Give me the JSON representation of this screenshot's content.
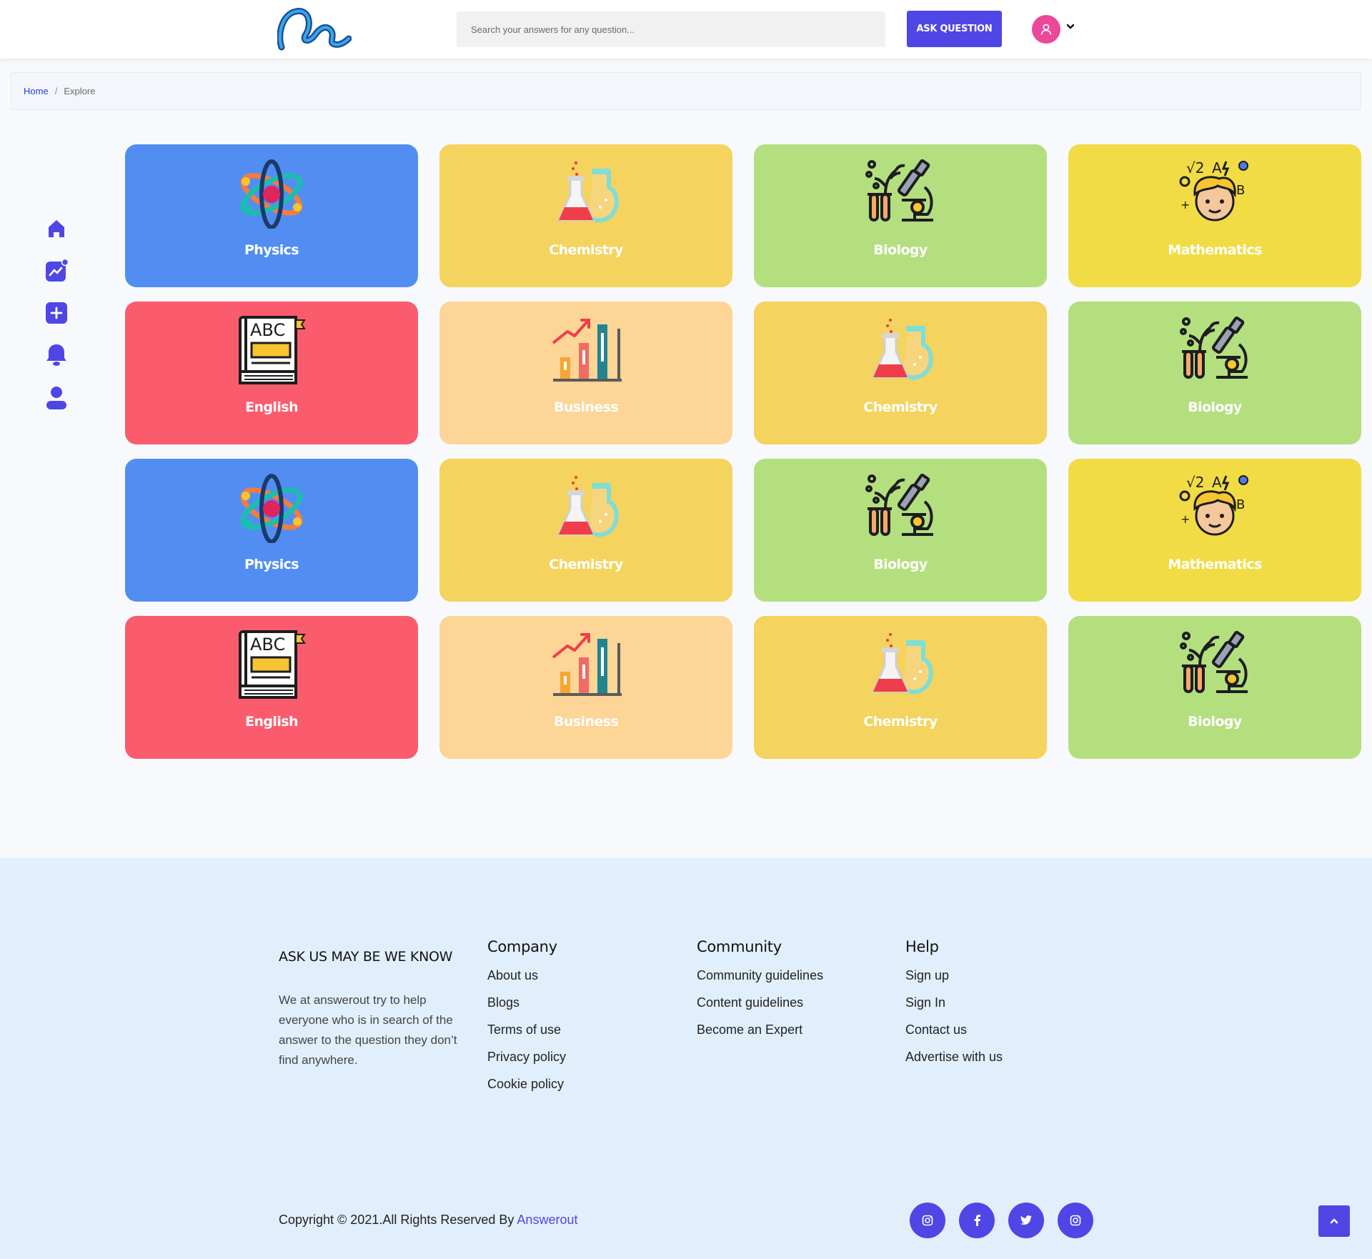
{
  "header": {
    "logo_icon": "answerout-logo-icon",
    "search_placeholder": "Search your answers for any question...",
    "ask_button": "ASK QUESTION",
    "avatar_icon": "user-icon",
    "avatar_color": "#ec4899",
    "accent": "#4f46e5"
  },
  "breadcrumb": {
    "home": "Home",
    "separator": "/",
    "current": "Explore"
  },
  "sidenav": [
    {
      "name": "home-icon"
    },
    {
      "name": "trending-icon"
    },
    {
      "name": "add-icon"
    },
    {
      "name": "bell-icon"
    },
    {
      "name": "profile-icon"
    }
  ],
  "subjects": [
    {
      "label": "Physics",
      "icon": "atom-icon",
      "color": "#528ef1"
    },
    {
      "label": "Chemistry",
      "icon": "flask-icon",
      "color": "#f4d35e"
    },
    {
      "label": "Biology",
      "icon": "microscope-icon",
      "color": "#b4df7f"
    },
    {
      "label": "Mathematics",
      "icon": "math-kid-icon",
      "color": "#f2dc45"
    },
    {
      "label": "English",
      "icon": "abc-book-icon",
      "color": "#fa5c6e"
    },
    {
      "label": "Business",
      "icon": "bar-chart-icon",
      "color": "#fcd597"
    },
    {
      "label": "Chemistry",
      "icon": "flask-icon",
      "color": "#f4d35e"
    },
    {
      "label": "Biology",
      "icon": "microscope-icon",
      "color": "#b4df7f"
    },
    {
      "label": "Physics",
      "icon": "atom-icon",
      "color": "#528ef1"
    },
    {
      "label": "Chemistry",
      "icon": "flask-icon",
      "color": "#f4d35e"
    },
    {
      "label": "Biology",
      "icon": "microscope-icon",
      "color": "#b4df7f"
    },
    {
      "label": "Mathematics",
      "icon": "math-kid-icon",
      "color": "#f2dc45"
    },
    {
      "label": "English",
      "icon": "abc-book-icon",
      "color": "#fa5c6e"
    },
    {
      "label": "Business",
      "icon": "bar-chart-icon",
      "color": "#fcd597"
    },
    {
      "label": "Chemistry",
      "icon": "flask-icon",
      "color": "#f4d35e"
    },
    {
      "label": "Biology",
      "icon": "microscope-icon",
      "color": "#b4df7f"
    }
  ],
  "footer": {
    "about_title": "ASK US MAY BE WE KNOW",
    "about_text": "We at answerout try to help everyone who is in search of the answer to the question they don’t find anywhere.",
    "columns": [
      {
        "title": "Company",
        "links": [
          "About us",
          "Blogs",
          "Terms of use",
          "Privacy policy",
          "Cookie policy"
        ]
      },
      {
        "title": "Community",
        "links": [
          "Community guidelines",
          "Content guidelines",
          "Become an Expert"
        ]
      },
      {
        "title": "Help",
        "links": [
          "Sign up",
          "Sign In",
          "Contact us",
          "Advertise with us"
        ]
      }
    ],
    "copyright_prefix": "Copyright © 2021.All Rights Reserved By ",
    "copyright_brand": "Answerout",
    "social": [
      {
        "name": "instagram-icon"
      },
      {
        "name": "facebook-icon"
      },
      {
        "name": "twitter-icon"
      },
      {
        "name": "instagram-icon"
      }
    ],
    "scroll_top_icon": "chevron-up-icon",
    "background": "#e1effc"
  }
}
